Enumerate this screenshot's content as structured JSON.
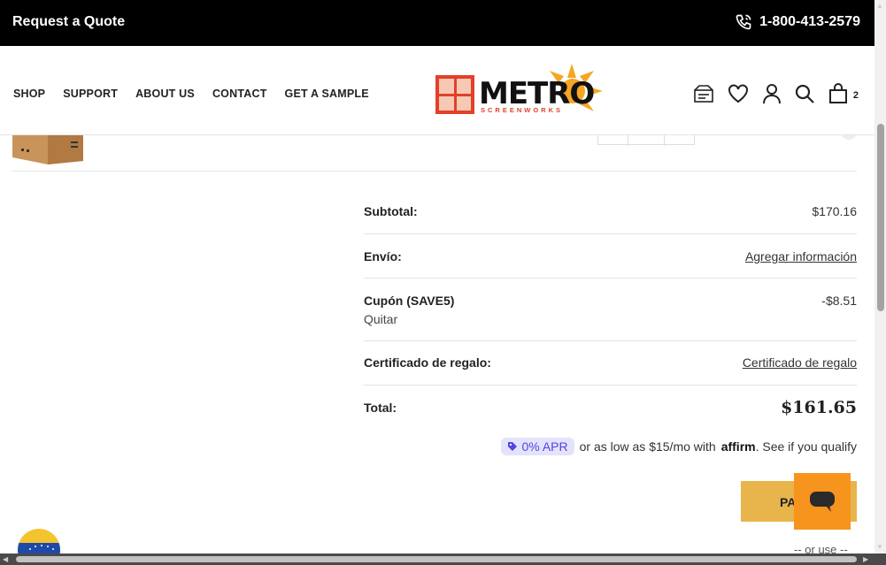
{
  "topbar": {
    "quote": "Request a Quote",
    "phone": "1-800-413-2579"
  },
  "nav": [
    "SHOP",
    "SUPPORT",
    "ABOUT US",
    "CONTACT",
    "GET A SAMPLE"
  ],
  "logo": {
    "name": "METRO",
    "sub": "SCREENWORKS"
  },
  "header": {
    "cart_count": "2"
  },
  "totals": {
    "subtotal_label": "Subtotal:",
    "subtotal_value": "$170.16",
    "shipping_label": "Envío:",
    "shipping_link": "Agregar información",
    "coupon_label": "Cupón (SAVE5)",
    "coupon_value": "-$8.51",
    "coupon_remove": "Quitar",
    "gift_label": "Certificado de regalo:",
    "gift_link": "Certificado de regalo",
    "total_label": "Total:",
    "total_value": "$161.65"
  },
  "affirm": {
    "apr": "0% APR",
    "text": "or as low as $15/mo with",
    "brand": "affirm",
    "qualify": ". See if you qualify"
  },
  "checkout": {
    "pay_label": "PA",
    "or_use": "-- or use --"
  },
  "icons": {
    "phone": "phone-icon",
    "sample": "sample-icon",
    "wishlist": "heart-icon",
    "account": "user-icon",
    "search": "search-icon",
    "cart": "bag-icon",
    "chat": "chat-icon"
  },
  "colors": {
    "topbar": "#000000",
    "accent": "#e8b54c",
    "chat": "#f7941d",
    "apr_bg": "#e5e2fb",
    "apr_text": "#5146e1"
  }
}
